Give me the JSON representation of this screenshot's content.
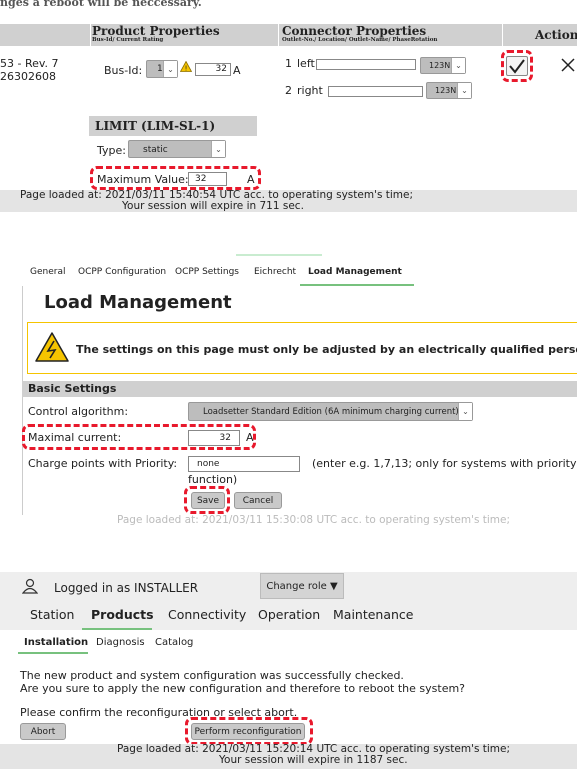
{
  "p1": {
    "top_text": "nges a reboot will be neccessary.",
    "col_product": "Product Properties",
    "col_product_sub": "Bus-Id/ Current Rating",
    "col_connector": "Connector Properties",
    "col_connector_sub": "Outlet-No./ Location/ Outlet-Name/ PhaseRotation",
    "col_actions": "Actions",
    "row_id_line1": "53 - Rev. 7",
    "row_id_line2": "26302608",
    "bus_label": "Bus-Id:",
    "bus_value": "1",
    "current_value": "32",
    "current_unit": "A",
    "outlets": [
      {
        "no": "1",
        "location": "left",
        "phase": "123N"
      },
      {
        "no": "2",
        "location": "right",
        "phase": "123N"
      }
    ],
    "limit_header": "LIMIT (LIM-SL-1)",
    "type_label": "Type:",
    "type_value": "static",
    "max_label": "Maximum Value:",
    "max_value": "32",
    "max_unit": "A",
    "footer_line1": "Page loaded at: 2021/03/11 15:40:54 UTC acc. to operating system's time;",
    "footer_line2": "Your session will expire in 711 sec."
  },
  "p2": {
    "tabs": [
      "General",
      "OCPP Configuration",
      "OCPP Settings",
      "Eichrecht",
      "Load Management"
    ],
    "title": "Load Management",
    "warning": "The settings on this page must only be adjusted by an electrically qualified person.",
    "section": "Basic Settings",
    "control_label": "Control algorithm:",
    "control_value": "Loadsetter Standard Edition (6A minimum charging current)",
    "maxcur_label": "Maximal current:",
    "maxcur_value": "32",
    "maxcur_unit": "A",
    "priority_label": "Charge points with Priority:",
    "priority_value": "none",
    "priority_hint1": "(enter e.g. 1,7,13; only for systems with priority",
    "priority_hint2": "function)",
    "save": "Save",
    "cancel": "Cancel",
    "footer": "Page loaded at: 2021/03/11 15:30:08 UTC acc. to operating system's time;"
  },
  "p3": {
    "logged_in": "Logged in as INSTALLER",
    "change_role": "Change role ▼",
    "main_tabs": [
      "Station",
      "Products",
      "Connectivity",
      "Operation",
      "Maintenance"
    ],
    "sub_tabs": [
      "Installation",
      "Diagnosis",
      "Catalog"
    ],
    "msg1": "The new product and system configuration was successfully checked.",
    "msg2": "Are you sure to apply the new configuration and therefore to reboot the system?",
    "confirm": "Please confirm the reconfiguration or select abort.",
    "abort": "Abort",
    "perform": "Perform reconfiguration",
    "footer_line1": "Page loaded at: 2021/03/11 15:20:14 UTC acc. to operating system's time;",
    "footer_line2": "Your session will expire in 1187 sec."
  },
  "colors": {
    "accent_red": "#e8192c",
    "warning_yellow": "#f5c400",
    "tab_green": "#77c17e",
    "header_grey": "#d0d0d0"
  }
}
